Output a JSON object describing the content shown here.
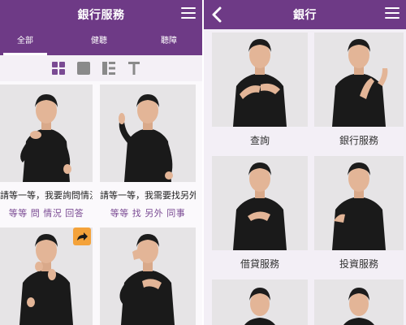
{
  "left": {
    "title": "銀行服務",
    "tabs": [
      "全部",
      "健聽",
      "聽障"
    ],
    "view_toggles": [
      "grid-view-icon",
      "single-view-icon",
      "list-view-icon",
      "text-view-icon"
    ],
    "cards": [
      {
        "caption": "請等一等，我要詢問情況",
        "keywords": "等等 問 情況 回答"
      },
      {
        "caption": "請等一等，我需要找另外同事",
        "keywords": "等等 找 另外 同事"
      },
      {
        "caption": "",
        "keywords": ""
      },
      {
        "caption": "",
        "keywords": ""
      }
    ]
  },
  "right": {
    "title": "銀行",
    "items": [
      "查詢",
      "銀行服務",
      "借貸服務",
      "投資服務",
      "",
      ""
    ]
  },
  "colors": {
    "brand_purple": "#6e3a86",
    "accent_orange": "#f4a23a",
    "keyword_purple": "#7a4a93"
  }
}
